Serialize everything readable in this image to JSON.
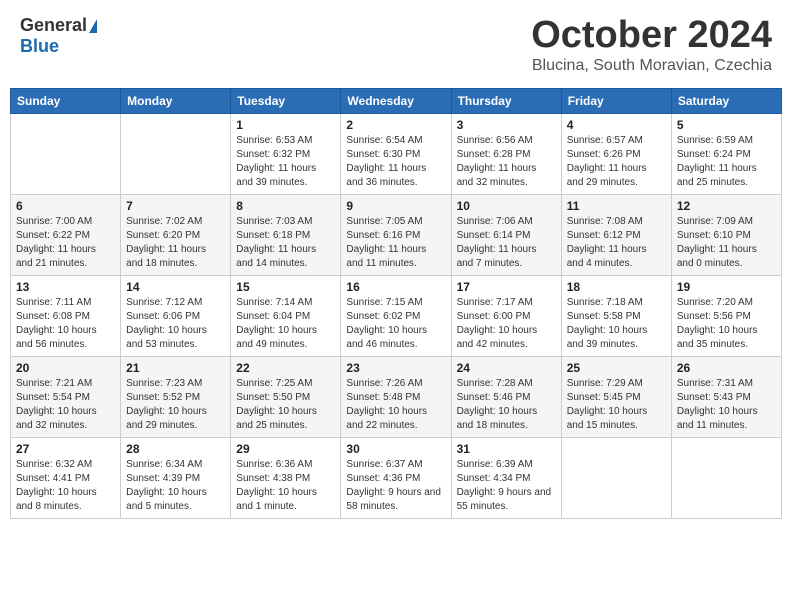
{
  "header": {
    "logo_general": "General",
    "logo_blue": "Blue",
    "month_title": "October 2024",
    "location": "Blucina, South Moravian, Czechia"
  },
  "weekdays": [
    "Sunday",
    "Monday",
    "Tuesday",
    "Wednesday",
    "Thursday",
    "Friday",
    "Saturday"
  ],
  "weeks": [
    [
      {
        "day": "",
        "info": ""
      },
      {
        "day": "",
        "info": ""
      },
      {
        "day": "1",
        "info": "Sunrise: 6:53 AM\nSunset: 6:32 PM\nDaylight: 11 hours and 39 minutes."
      },
      {
        "day": "2",
        "info": "Sunrise: 6:54 AM\nSunset: 6:30 PM\nDaylight: 11 hours and 36 minutes."
      },
      {
        "day": "3",
        "info": "Sunrise: 6:56 AM\nSunset: 6:28 PM\nDaylight: 11 hours and 32 minutes."
      },
      {
        "day": "4",
        "info": "Sunrise: 6:57 AM\nSunset: 6:26 PM\nDaylight: 11 hours and 29 minutes."
      },
      {
        "day": "5",
        "info": "Sunrise: 6:59 AM\nSunset: 6:24 PM\nDaylight: 11 hours and 25 minutes."
      }
    ],
    [
      {
        "day": "6",
        "info": "Sunrise: 7:00 AM\nSunset: 6:22 PM\nDaylight: 11 hours and 21 minutes."
      },
      {
        "day": "7",
        "info": "Sunrise: 7:02 AM\nSunset: 6:20 PM\nDaylight: 11 hours and 18 minutes."
      },
      {
        "day": "8",
        "info": "Sunrise: 7:03 AM\nSunset: 6:18 PM\nDaylight: 11 hours and 14 minutes."
      },
      {
        "day": "9",
        "info": "Sunrise: 7:05 AM\nSunset: 6:16 PM\nDaylight: 11 hours and 11 minutes."
      },
      {
        "day": "10",
        "info": "Sunrise: 7:06 AM\nSunset: 6:14 PM\nDaylight: 11 hours and 7 minutes."
      },
      {
        "day": "11",
        "info": "Sunrise: 7:08 AM\nSunset: 6:12 PM\nDaylight: 11 hours and 4 minutes."
      },
      {
        "day": "12",
        "info": "Sunrise: 7:09 AM\nSunset: 6:10 PM\nDaylight: 11 hours and 0 minutes."
      }
    ],
    [
      {
        "day": "13",
        "info": "Sunrise: 7:11 AM\nSunset: 6:08 PM\nDaylight: 10 hours and 56 minutes."
      },
      {
        "day": "14",
        "info": "Sunrise: 7:12 AM\nSunset: 6:06 PM\nDaylight: 10 hours and 53 minutes."
      },
      {
        "day": "15",
        "info": "Sunrise: 7:14 AM\nSunset: 6:04 PM\nDaylight: 10 hours and 49 minutes."
      },
      {
        "day": "16",
        "info": "Sunrise: 7:15 AM\nSunset: 6:02 PM\nDaylight: 10 hours and 46 minutes."
      },
      {
        "day": "17",
        "info": "Sunrise: 7:17 AM\nSunset: 6:00 PM\nDaylight: 10 hours and 42 minutes."
      },
      {
        "day": "18",
        "info": "Sunrise: 7:18 AM\nSunset: 5:58 PM\nDaylight: 10 hours and 39 minutes."
      },
      {
        "day": "19",
        "info": "Sunrise: 7:20 AM\nSunset: 5:56 PM\nDaylight: 10 hours and 35 minutes."
      }
    ],
    [
      {
        "day": "20",
        "info": "Sunrise: 7:21 AM\nSunset: 5:54 PM\nDaylight: 10 hours and 32 minutes."
      },
      {
        "day": "21",
        "info": "Sunrise: 7:23 AM\nSunset: 5:52 PM\nDaylight: 10 hours and 29 minutes."
      },
      {
        "day": "22",
        "info": "Sunrise: 7:25 AM\nSunset: 5:50 PM\nDaylight: 10 hours and 25 minutes."
      },
      {
        "day": "23",
        "info": "Sunrise: 7:26 AM\nSunset: 5:48 PM\nDaylight: 10 hours and 22 minutes."
      },
      {
        "day": "24",
        "info": "Sunrise: 7:28 AM\nSunset: 5:46 PM\nDaylight: 10 hours and 18 minutes."
      },
      {
        "day": "25",
        "info": "Sunrise: 7:29 AM\nSunset: 5:45 PM\nDaylight: 10 hours and 15 minutes."
      },
      {
        "day": "26",
        "info": "Sunrise: 7:31 AM\nSunset: 5:43 PM\nDaylight: 10 hours and 11 minutes."
      }
    ],
    [
      {
        "day": "27",
        "info": "Sunrise: 6:32 AM\nSunset: 4:41 PM\nDaylight: 10 hours and 8 minutes."
      },
      {
        "day": "28",
        "info": "Sunrise: 6:34 AM\nSunset: 4:39 PM\nDaylight: 10 hours and 5 minutes."
      },
      {
        "day": "29",
        "info": "Sunrise: 6:36 AM\nSunset: 4:38 PM\nDaylight: 10 hours and 1 minute."
      },
      {
        "day": "30",
        "info": "Sunrise: 6:37 AM\nSunset: 4:36 PM\nDaylight: 9 hours and 58 minutes."
      },
      {
        "day": "31",
        "info": "Sunrise: 6:39 AM\nSunset: 4:34 PM\nDaylight: 9 hours and 55 minutes."
      },
      {
        "day": "",
        "info": ""
      },
      {
        "day": "",
        "info": ""
      }
    ]
  ]
}
